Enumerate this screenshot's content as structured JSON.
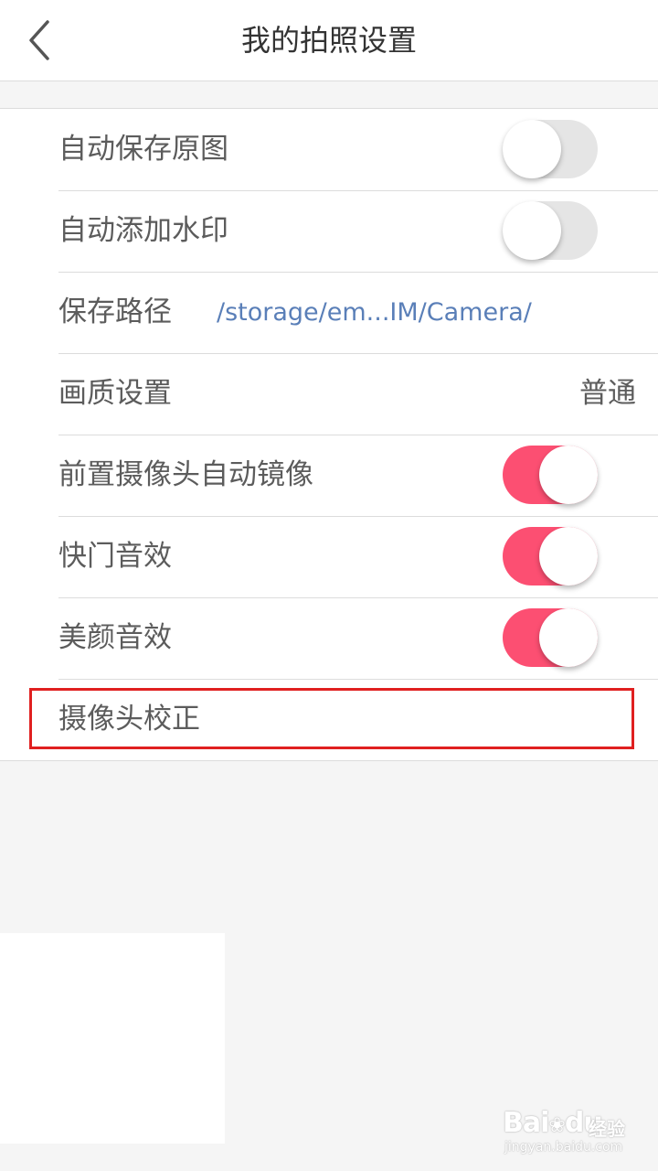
{
  "header": {
    "title": "我的拍照设置",
    "back_icon": "chevron-left-icon"
  },
  "settings": {
    "auto_save_original": {
      "label": "自动保存原图",
      "enabled": false
    },
    "auto_watermark": {
      "label": "自动添加水印",
      "enabled": false
    },
    "save_path": {
      "label": "保存路径",
      "value": "/storage/em...IM/Camera/"
    },
    "quality": {
      "label": "画质设置",
      "value": "普通"
    },
    "front_camera_mirror": {
      "label": "前置摄像头自动镜像",
      "enabled": true
    },
    "shutter_sound": {
      "label": "快门音效",
      "enabled": true
    },
    "beauty_sound": {
      "label": "美颜音效",
      "enabled": true
    },
    "camera_calibration": {
      "label": "摄像头校正"
    }
  },
  "watermark": {
    "brand": "Bai",
    "paw_icon": "baidu-paw-icon",
    "brand_suffix": "du",
    "sub": "经验",
    "url": "jingyan.baidu.com"
  },
  "colors": {
    "accent": "#fc4f72",
    "toggle_off": "#e5e5e5",
    "link": "#5a7fb8",
    "highlight": "#e02020",
    "background": "#f5f5f5"
  }
}
